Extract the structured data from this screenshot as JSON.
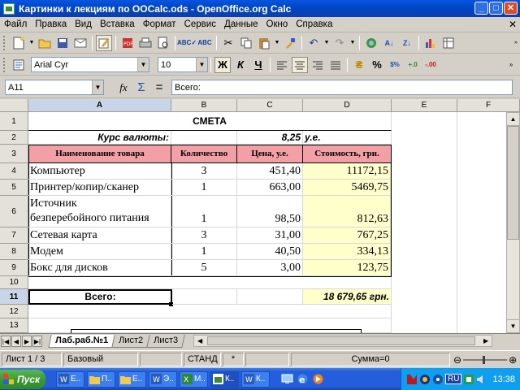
{
  "window": {
    "title": "Картинки к лекциям по OOCalc.ods - OpenOffice.org Calc"
  },
  "menu": [
    "Файл",
    "Правка",
    "Вид",
    "Вставка",
    "Формат",
    "Сервис",
    "Данные",
    "Окно",
    "Справка"
  ],
  "format": {
    "font": "Arial Cyr",
    "size": "10",
    "bold_label": "Ж",
    "italic_label": "К",
    "underline_label": "Ч"
  },
  "formula_bar": {
    "cell_ref": "A11",
    "content": "Всего:",
    "fx_label": "fx",
    "sum_label": "Σ",
    "eq_label": "="
  },
  "columns": [
    "A",
    "B",
    "C",
    "D",
    "E",
    "F"
  ],
  "rows": [
    "1",
    "2",
    "3",
    "4",
    "5",
    "6",
    "7",
    "8",
    "9",
    "10",
    "11",
    "12",
    "13"
  ],
  "sheet": {
    "title": "СМЕТА",
    "rate_label": "Курс валюты:",
    "rate_value": "8,25",
    "rate_unit": "у.е.",
    "headers": [
      "Наименование товара",
      "Количество",
      "Цена, у.е.",
      "Стоимость, грн."
    ],
    "items": [
      {
        "name": "Компьютер",
        "qty": "3",
        "price": "451,40",
        "cost": "11172,15"
      },
      {
        "name": "Принтер/копир/сканер",
        "qty": "1",
        "price": "663,00",
        "cost": "5469,75"
      },
      {
        "name1": "Источник",
        "name2": "безперебойного питания",
        "qty": "1",
        "price": "98,50",
        "cost": "812,63"
      },
      {
        "name": "Сетевая карта",
        "qty": "3",
        "price": "31,00",
        "cost": "767,25"
      },
      {
        "name": "Модем",
        "qty": "1",
        "price": "40,50",
        "cost": "334,13"
      },
      {
        "name": "Бокс для дисков",
        "qty": "5",
        "price": "3,00",
        "cost": "123,75"
      }
    ],
    "total_label": "Всего:",
    "total_value": "18 679,65 грн."
  },
  "tabs": [
    "Лаб.раб.№1",
    "Лист2",
    "Лист3"
  ],
  "status": {
    "sheet": "Лист 1 / 3",
    "style": "Базовый",
    "mode": "СТАНД",
    "modified": "*",
    "sum": "Сумма=0"
  },
  "taskbar": {
    "start_label": "Пуск",
    "tasks": [
      "Е..",
      "П..",
      "Е..",
      "Э..",
      "М..",
      "К..",
      "К.."
    ],
    "lang": "RU",
    "clock": "13:38"
  },
  "colors": {
    "header_fill": "#f2a0a6",
    "cost_fill": "#ffffcc",
    "title_blue": "#0a55e0"
  }
}
